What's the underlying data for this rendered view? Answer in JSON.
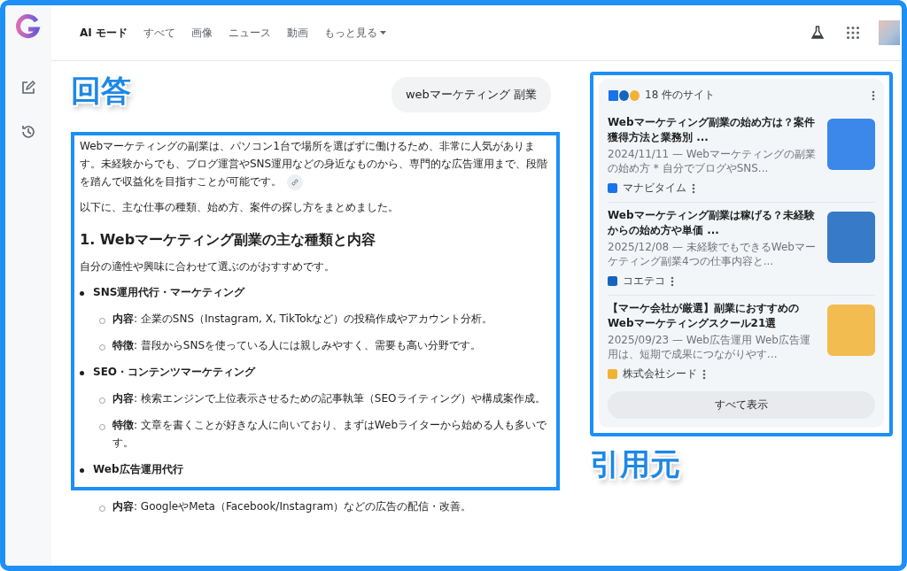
{
  "nav": {
    "tabs": [
      {
        "label": "AI モード",
        "selected": true
      },
      {
        "label": "すべて",
        "selected": false
      },
      {
        "label": "画像",
        "selected": false
      },
      {
        "label": "ニュース",
        "selected": false
      },
      {
        "label": "動画",
        "selected": false
      },
      {
        "label": "もっと見る",
        "selected": false,
        "dropdown": true
      }
    ]
  },
  "annotations": {
    "answer_label": "回答",
    "sources_label": "引用元"
  },
  "query": "webマーケティング 副業",
  "answer": {
    "blocks": [
      {
        "kind": "paragraph",
        "text": "Webマーケティングの副業は、パソコン1台で場所を選ばずに働けるため、非常に人気があります。未経験からでも、ブログ運営やSNS運用などの身近なものから、専門的な広告運用まで、段階を踏んで収益化を目指すことが可能です。",
        "link": true
      },
      {
        "kind": "paragraph",
        "text": "以下に、主な仕事の種類、始め方、案件の探し方をまとめました。"
      },
      {
        "kind": "heading",
        "text": "1. Webマーケティング副業の主な種類と内容"
      },
      {
        "kind": "paragraph",
        "text": "自分の適性や興味に合わせて選ぶのがおすすめです。"
      },
      {
        "kind": "bullet",
        "text": "SNS運用代行・マーケティング",
        "children": [
          "**内容**: 企業のSNS（Instagram, X, TikTokなど）の投稿作成やアカウント分析。",
          "**特徴**: 普段からSNSを使っている人には親しみやすく、需要も高い分野です。"
        ]
      },
      {
        "kind": "bullet",
        "text": "SEO・コンテンツマーケティング",
        "children": [
          "**内容**: 検索エンジンで上位表示させるための記事執筆（SEOライティング）や構成案作成。",
          "**特徴**: 文章を書くことが好きな人に向いており、まずはWebライターから始める人も多いです。"
        ]
      },
      {
        "kind": "bullet",
        "text": "Web広告運用代行"
      }
    ],
    "continued": [
      "**内容**: GoogleやMeta（Facebook/Instagram）などの広告の配信・改善。"
    ]
  },
  "sources": {
    "count": "18 件のサイト",
    "items": [
      {
        "title": "Webマーケティング副業の始め方は？案件獲得方法と業務別 ...",
        "snippet": "2024/11/11 — Webマーケティングの副業の始め方 * 自分でブログやSNS...",
        "site": "マナビタイム",
        "color": "#1a73e8"
      },
      {
        "title": "Webマーケティング副業は稼げる？未経験からの始め方や単価 ...",
        "snippet": "2025/12/08 — 未経験でもできるWebマーケティング副業4つの仕事内容と...",
        "site": "コエテコ",
        "color": "#1565c0"
      },
      {
        "title": "【マーケ会社が厳選】副業におすすめのWebマーケティングスクール21選",
        "snippet": "2025/09/23 — Web広告運用 Web広告運用は、短期で成果につながりやす...",
        "site": "株式会社シード",
        "color": "#f2b233"
      }
    ],
    "show_all": "すべて表示"
  }
}
